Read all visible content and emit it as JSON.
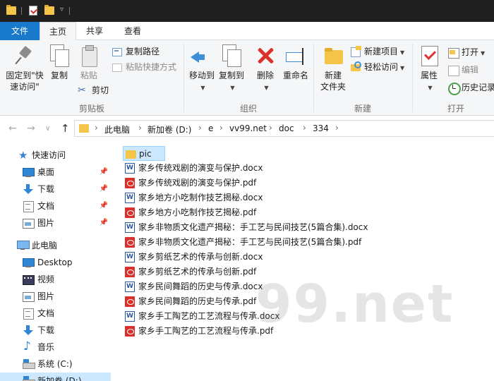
{
  "ribbon_tabs": {
    "file": "文件",
    "home": "主页",
    "share": "共享",
    "view": "查看"
  },
  "ribbon": {
    "clipboard": {
      "pin_quick_access_line1": "固定到\"快",
      "pin_quick_access_line2": "速访问\"",
      "copy": "复制",
      "paste": "粘贴",
      "copy_path": "复制路径",
      "paste_shortcut": "粘贴快捷方式",
      "cut": "剪切",
      "group_label": "剪贴板"
    },
    "organize": {
      "move_to": "移动到",
      "copy_to": "复制到",
      "delete": "删除",
      "rename": "重命名",
      "group_label": "组织"
    },
    "new": {
      "new_folder_line1": "新建",
      "new_folder_line2": "文件夹",
      "new_item": "新建项目",
      "easy_access": "轻松访问",
      "group_label": "新建"
    },
    "open": {
      "properties": "属性",
      "open": "打开",
      "edit": "编辑",
      "history": "历史记录",
      "group_label": "打开"
    }
  },
  "navigation": {
    "back_icon": "←",
    "forward_icon": "→",
    "recent_icon": "∨",
    "up_icon": "↑"
  },
  "breadcrumb": [
    "此电脑",
    "新加卷 (D:)",
    "e",
    "vv99.net",
    "doc",
    "334"
  ],
  "nav_pane": {
    "quick_access": "快速访问",
    "desktop": "桌面",
    "downloads": "下载",
    "documents": "文档",
    "pictures": "图片",
    "this_pc": "此电脑",
    "pc_desktop": "Desktop",
    "pc_videos": "视频",
    "pc_pictures": "图片",
    "pc_documents": "文档",
    "pc_downloads": "下载",
    "pc_music": "音乐",
    "drive_c": "系统 (C:)",
    "drive_d": "新加卷 (D:)"
  },
  "files": [
    {
      "name": "pic",
      "type": "folder"
    },
    {
      "name": "家乡传统戏剧的演变与保护.docx",
      "type": "docx"
    },
    {
      "name": "家乡传统戏剧的演变与保护.pdf",
      "type": "pdf"
    },
    {
      "name": "家乡地方小吃制作技艺揭秘.docx",
      "type": "docx"
    },
    {
      "name": "家乡地方小吃制作技艺揭秘.pdf",
      "type": "pdf"
    },
    {
      "name": "家乡非物质文化遗产揭秘：手工艺与民间技艺(5篇合集).docx",
      "type": "docx"
    },
    {
      "name": "家乡非物质文化遗产揭秘：手工艺与民间技艺(5篇合集).pdf",
      "type": "pdf"
    },
    {
      "name": "家乡剪纸艺术的传承与创新.docx",
      "type": "docx"
    },
    {
      "name": "家乡剪纸艺术的传承与创新.pdf",
      "type": "pdf"
    },
    {
      "name": "家乡民间舞蹈的历史与传承.docx",
      "type": "docx"
    },
    {
      "name": "家乡民间舞蹈的历史与传承.pdf",
      "type": "pdf"
    },
    {
      "name": "家乡手工陶艺的工艺流程与传承.docx",
      "type": "docx"
    },
    {
      "name": "家乡手工陶艺的工艺流程与传承.pdf",
      "type": "pdf"
    }
  ],
  "watermark": "99.net",
  "colors": {
    "file_tab": "#1979ca",
    "selection": "#cce8ff",
    "folder": "#f5c54a",
    "delete_red": "#d9322b"
  }
}
